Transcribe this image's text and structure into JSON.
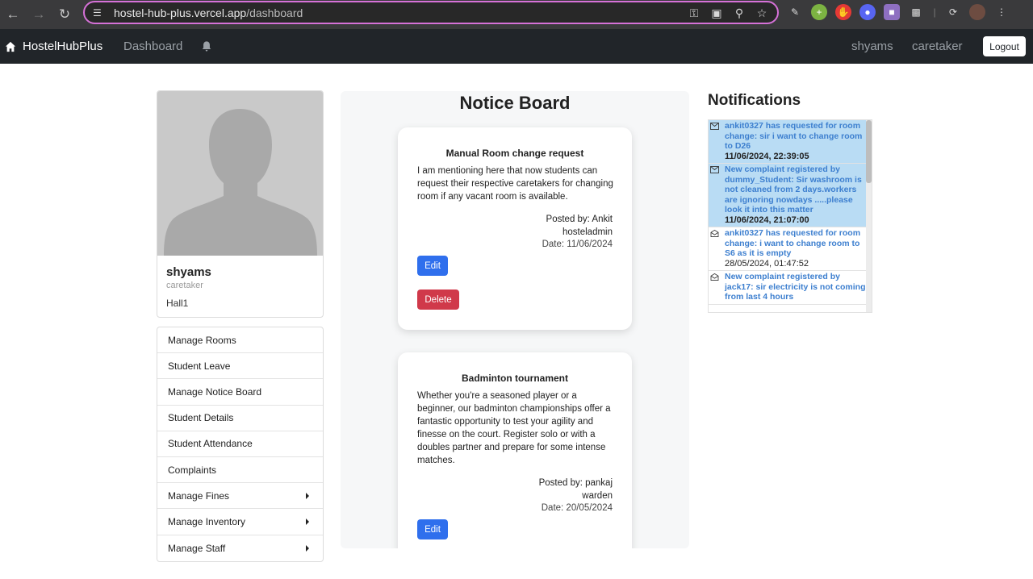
{
  "browser": {
    "url_host": "hostel-hub-plus.vercel.app",
    "url_path": "/dashboard"
  },
  "navbar": {
    "brand": "HostelHubPlus",
    "dashboard": "Dashboard",
    "username": "shyams",
    "role": "caretaker",
    "logout": "Logout"
  },
  "profile": {
    "name": "shyams",
    "role": "caretaker",
    "hall": "Hall1"
  },
  "menu": {
    "items": [
      {
        "label": "Manage Rooms"
      },
      {
        "label": "Student Leave"
      },
      {
        "label": "Manage Notice Board"
      },
      {
        "label": "Student Details"
      },
      {
        "label": "Student Attendance"
      },
      {
        "label": "Complaints"
      },
      {
        "label": "Manage Fines"
      },
      {
        "label": "Manage Inventory"
      },
      {
        "label": "Manage Staff"
      }
    ]
  },
  "noticeboard": {
    "title": "Notice Board",
    "notices": [
      {
        "title": "Manual Room change request",
        "body": "I am mentioning here that now students can request their respective caretakers for changing room if any vacant room is available.",
        "posted_by": "Posted by: Ankit",
        "posted_role": "hosteladmin",
        "date": "Date: 11/06/2024",
        "edit": "Edit",
        "delete": "Delete"
      },
      {
        "title": "Badminton tournament",
        "body": "Whether you're a seasoned player or a beginner, our badminton championships offer a fantastic opportunity to test your agility and finesse on the court. Register solo or with a doubles partner and prepare for some intense matches.",
        "posted_by": "Posted by: pankaj",
        "posted_role": "warden",
        "date": "Date: 20/05/2024",
        "edit": "Edit"
      }
    ]
  },
  "notifications": {
    "title": "Notifications",
    "items": [
      {
        "text": "ankit0327 has requested for room change: sir i want to change room to D26",
        "time": "11/06/2024, 22:39:05",
        "unread": true
      },
      {
        "text": "New complaint registered by dummy_Student: Sir washroom is not cleaned from 2 days.workers are ignoring nowdays .....please look it into this matter",
        "time": "11/06/2024, 21:07:00",
        "unread": true
      },
      {
        "text": "ankit0327 has requested for room change: i want to change room to S6 as it is empty",
        "time": "28/05/2024, 01:47:52",
        "unread": false
      },
      {
        "text": "New complaint registered by jack17: sir electricity is not coming from last 4 hours",
        "time": "",
        "unread": false
      }
    ]
  },
  "colors": {
    "navbar_bg": "#212529",
    "primary": "#2f6fed",
    "danger": "#d0394a",
    "unread_bg": "#b9dcf4",
    "notif_link": "#3d7fcf"
  }
}
